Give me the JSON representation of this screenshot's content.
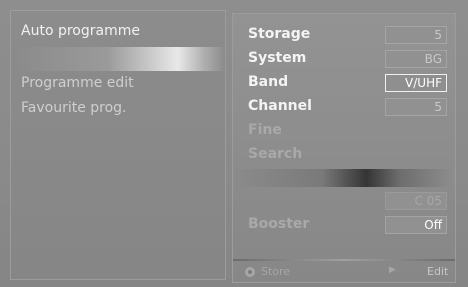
{
  "left_menu": {
    "items": [
      {
        "label": "Auto programme"
      },
      {
        "label": "Programme edit"
      },
      {
        "label": "Favourite prog."
      }
    ]
  },
  "right_panel": {
    "rows": [
      {
        "label": "Storage",
        "value": "5"
      },
      {
        "label": "System",
        "value": "BG"
      },
      {
        "label": "Band",
        "value": "V/UHF"
      },
      {
        "label": "Channel",
        "value": "5"
      },
      {
        "label": "Fine",
        "value": ""
      },
      {
        "label": "Search",
        "value": ""
      }
    ],
    "extra_value": "C 05",
    "booster": {
      "label": "Booster",
      "value": "Off"
    },
    "footer": {
      "store_label": "Store",
      "edit_label": "Edit"
    }
  }
}
